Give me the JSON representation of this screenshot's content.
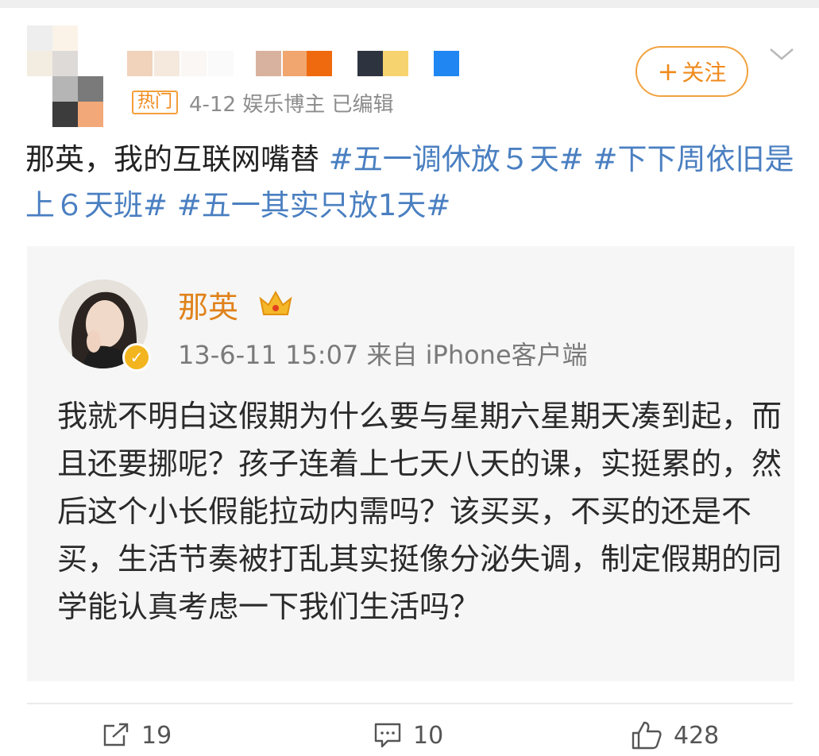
{
  "header": {
    "hot_badge": "热门",
    "meta_text": "4-12  娱乐博主  已编辑",
    "follow_label": "关注",
    "follow_plus": "+",
    "avatar_pixels": [
      "#eeeeee",
      "#fbf3e8",
      "#f3ece0",
      "#dedad8",
      "#b5b5b5",
      "#7a7a7a",
      "#3c3c3c",
      "#f2a878"
    ],
    "username_pixels": [
      "#f1d2bb",
      "#f5e8dd",
      "#faf7f5",
      "#fafafa",
      "#d8b29f",
      "#f0a66e",
      "#ef6a0f",
      "#2e3340",
      "#f7d36f",
      "#ffffff",
      "#1f86f2"
    ]
  },
  "post": {
    "text_plain": "那英，我的互联网嘴替 ",
    "tags": [
      "#五一调休放５天#",
      "#下下周依旧是上６天班#",
      "#五一其实只放1天#"
    ]
  },
  "embedded": {
    "name": "那英",
    "meta": "13-6-11 15:07  来自 iPhone客户端",
    "body": "我就不明白这假期为什么要与星期六星期天凑到起，而且还要挪呢？孩子连着上七天八天的课，实挺累的，然后这个小长假能拉动内需吗？该买买，不买的还是不买，生活节奏被打乱其实挺像分泌失调，制定假期的同学能认真考虑一下我们生活吗？"
  },
  "actions": {
    "repost_count": "19",
    "comment_count": "10",
    "like_count": "428"
  },
  "colors": {
    "accent_orange": "#f08a1c",
    "tag_blue": "#4a7fc1",
    "meta_gray": "#8c8c8c",
    "name_orange": "#e0821a"
  },
  "icons": [
    "chevron-down-icon",
    "repost-icon",
    "comment-icon",
    "like-icon",
    "verified-icon",
    "crown-icon"
  ]
}
